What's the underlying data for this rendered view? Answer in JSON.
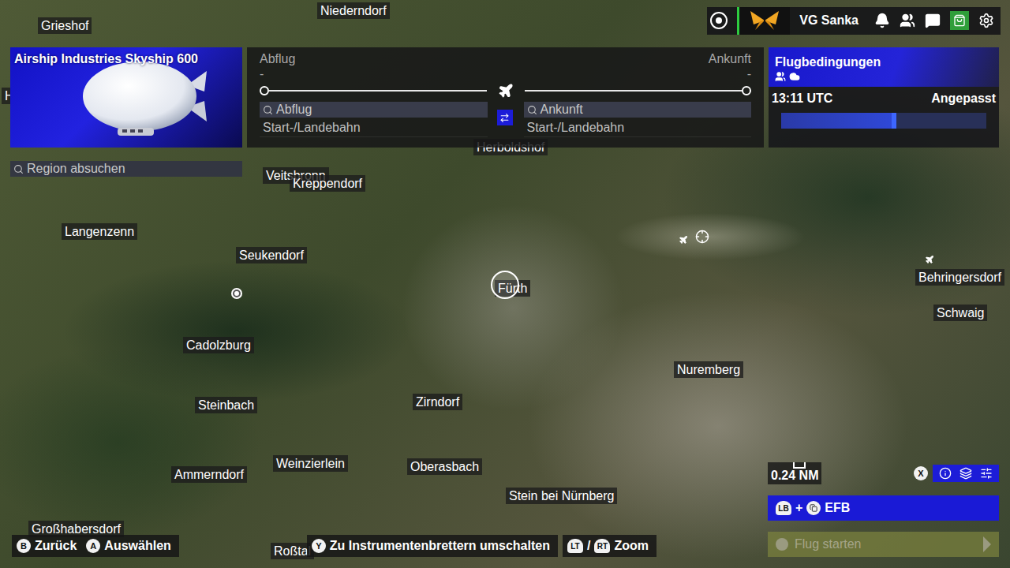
{
  "header": {
    "username": "VG Sanka"
  },
  "aircraft": {
    "name": "Airship Industries Skyship 600"
  },
  "route": {
    "departure_label": "Abflug",
    "arrival_label": "Ankunft",
    "departure_value": "-",
    "arrival_value": "-",
    "departure_search": "Abflug",
    "arrival_search": "Ankunft",
    "departure_runway": "Start-/Landebahn",
    "arrival_runway": "Start-/Landebahn"
  },
  "conditions": {
    "title": "Flugbedingungen",
    "time": "13:11 UTC",
    "preset": "Angepasst",
    "level": 0.55
  },
  "region_search": {
    "placeholder": "Region absuchen"
  },
  "map": {
    "labels": [
      "Grieshof",
      "Niederndorf",
      "H",
      "Herboldshof",
      "Veitsbronn",
      "Kreppendorf",
      "Langenzenn",
      "Seukendorf",
      "Fürth",
      "Cadolzburg",
      "Steinbach",
      "Zirndorf",
      "Nuremberg",
      "Behringersdorf",
      "Schwaig",
      "Ammerndorf",
      "Weinzierlein",
      "Oberasbach",
      "Stein bei Nürnberg",
      "Großhabersdorf",
      "Roßtal"
    ],
    "markers": [
      {
        "kind": "airport"
      },
      {
        "kind": "poi"
      },
      {
        "kind": "plane"
      },
      {
        "kind": "plane"
      },
      {
        "kind": "cursor"
      }
    ],
    "scale": "0.24 NM"
  },
  "map_tools_key": "X",
  "control_groups": [
    {
      "items": [
        {
          "keys": [
            "B"
          ],
          "label": "Zurück"
        },
        {
          "keys": [
            "A"
          ],
          "label": "Auswählen"
        }
      ]
    },
    {
      "items": [
        {
          "keys": [
            "Y"
          ],
          "label": "Zu Instrumentenbrettern umschalten"
        }
      ]
    },
    {
      "items": [
        {
          "keys": [
            "LT",
            "RT"
          ],
          "separator": "/",
          "label": "Zoom"
        }
      ]
    }
  ],
  "efb": {
    "keys": [
      "LB"
    ],
    "plus": "+",
    "label": "EFB"
  },
  "start_button": {
    "label": "Flug starten",
    "disabled": true
  }
}
